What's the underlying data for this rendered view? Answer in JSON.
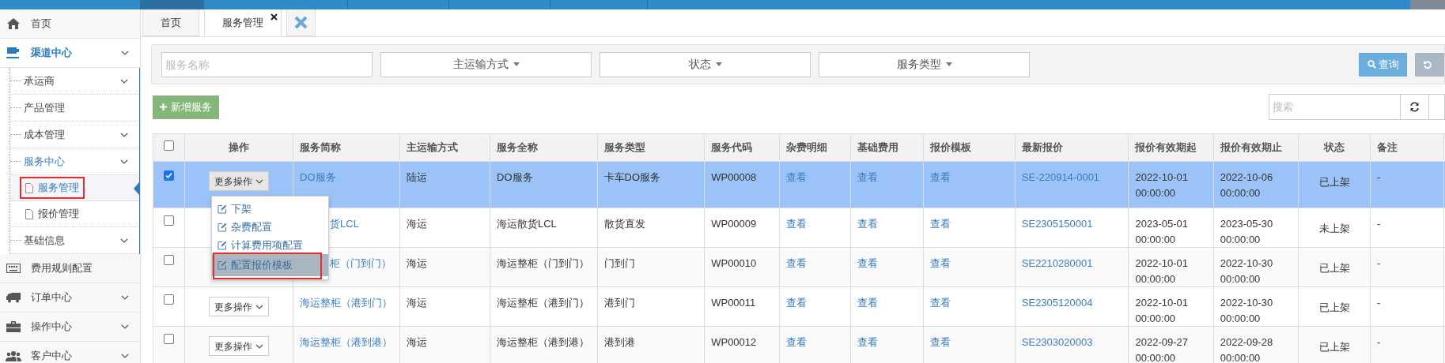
{
  "sidebar": {
    "items": [
      {
        "label": "首页",
        "expandable": false,
        "expanded": false
      },
      {
        "label": "渠道中心",
        "expandable": true,
        "expanded": true,
        "children": [
          {
            "label": "承运商",
            "expandable": true,
            "expanded": false
          },
          {
            "label": "产品管理",
            "expandable": false,
            "expanded": false
          },
          {
            "label": "成本管理",
            "expandable": true,
            "expanded": false
          },
          {
            "label": "服务中心",
            "expandable": true,
            "expanded": true,
            "children": [
              {
                "label": "服务管理",
                "selected": true,
                "annotated": true
              },
              {
                "label": "报价管理",
                "selected": false,
                "annotated": false
              }
            ]
          },
          {
            "label": "基础信息",
            "expandable": true,
            "expanded": false
          }
        ]
      },
      {
        "label": "费用规则配置",
        "expandable": false,
        "expanded": false
      },
      {
        "label": "订单中心",
        "expandable": true,
        "expanded": false
      },
      {
        "label": "操作中心",
        "expandable": true,
        "expanded": false
      },
      {
        "label": "客户中心",
        "expandable": true,
        "expanded": false
      }
    ]
  },
  "tabs": [
    {
      "label": "首页",
      "selected": false,
      "closable": false
    },
    {
      "label": "服务管理",
      "selected": true,
      "closable": true
    }
  ],
  "filters": {
    "name_field": {
      "placeholder": "服务名称"
    },
    "dropdowns": [
      "主运输方式",
      "状态",
      "服务类型"
    ],
    "query_button": "查询"
  },
  "add_button": "新增服务",
  "search": {
    "placeholder": "搜索"
  },
  "table": {
    "select_all": false,
    "columns": [
      "",
      "操作",
      "服务简称",
      "主运输方式",
      "服务全称",
      "服务类型",
      "服务代码",
      "杂费明细",
      "基础费用",
      "报价模板",
      "最新报价",
      "报价有效期起",
      "报价有效期止",
      "状态",
      "备注"
    ],
    "rows": [
      {
        "checked": true,
        "selected": true,
        "menu_open": true,
        "covered": false,
        "cells": [
          "",
          "更多操作",
          "DO服务",
          "陆运",
          "DO服务",
          "卡车DO服务",
          "WP00008",
          "查看",
          "查看",
          "查看",
          "SE-220914-0001",
          "2022-10-01 00:00:00",
          "2022-10-06 00:00:00",
          "已上架",
          "-"
        ]
      },
      {
        "checked": false,
        "selected": false,
        "covered": true,
        "cells": [
          "",
          "",
          "货LCL",
          "海运",
          "海运散货LCL",
          "散货直发",
          "WP00009",
          "查看",
          "查看",
          "查看",
          "SE2305150001",
          "2023-05-01 00:00:00",
          "2023-05-30 00:00:00",
          "未上架",
          "-"
        ]
      },
      {
        "checked": false,
        "selected": false,
        "covered": true,
        "cells": [
          "",
          "",
          "柜（门到门）",
          "海运",
          "海运整柜（门到门）",
          "门到门",
          "WP00010",
          "查看",
          "查看",
          "查看",
          "SE2210280001",
          "2022-10-01 00:00:00",
          "2022-10-30 00:00:00",
          "已上架",
          "-"
        ]
      },
      {
        "checked": false,
        "selected": false,
        "menu_open": false,
        "covered": false,
        "cells": [
          "",
          "更多操作",
          "海运整柜（港到门）",
          "海运",
          "海运整柜（港到门）",
          "港到门",
          "WP00011",
          "查看",
          "查看",
          "查看",
          "SE2305120004",
          "2022-10-01 00:00:00",
          "2022-10-30 00:00:00",
          "已上架",
          "-"
        ]
      },
      {
        "checked": false,
        "selected": false,
        "menu_open": false,
        "covered": false,
        "cells": [
          "",
          "更多操作",
          "海运整柜（港到港）",
          "海运",
          "海运整柜（港到港）",
          "港到港",
          "WP00012",
          "查看",
          "查看",
          "查看",
          "SE2303020003",
          "2022-09-27 00:00:00",
          "2022-09-28 00:00:00",
          "已上架",
          "-"
        ]
      }
    ]
  },
  "action_menu": [
    {
      "label": "下架",
      "highlighted": false,
      "annotated": false
    },
    {
      "label": "杂费配置",
      "highlighted": false,
      "annotated": false
    },
    {
      "label": "计算费用项配置",
      "highlighted": false,
      "annotated": false
    },
    {
      "label": "配置报价模板",
      "highlighted": true,
      "annotated": true
    }
  ]
}
